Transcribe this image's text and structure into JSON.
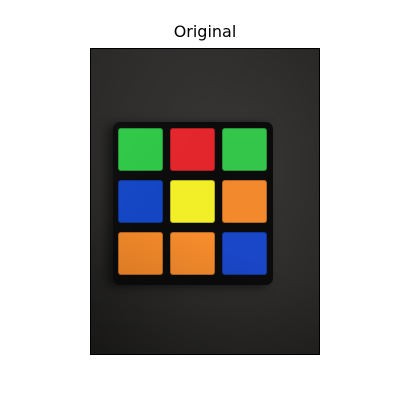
{
  "figure": {
    "title": "Original"
  },
  "cube": {
    "stickers": [
      {
        "name": "sticker-top-left",
        "color": "#2fc747"
      },
      {
        "name": "sticker-top-center",
        "color": "#e3262c"
      },
      {
        "name": "sticker-top-right",
        "color": "#33c64a"
      },
      {
        "name": "sticker-middle-left",
        "color": "#1446c4"
      },
      {
        "name": "sticker-center",
        "color": "#f2ee28"
      },
      {
        "name": "sticker-middle-right",
        "color": "#f28a2d"
      },
      {
        "name": "sticker-bottom-left",
        "color": "#f58a2a"
      },
      {
        "name": "sticker-bottom-center",
        "color": "#f58b2c"
      },
      {
        "name": "sticker-bottom-right",
        "color": "#1a47c8"
      }
    ]
  }
}
